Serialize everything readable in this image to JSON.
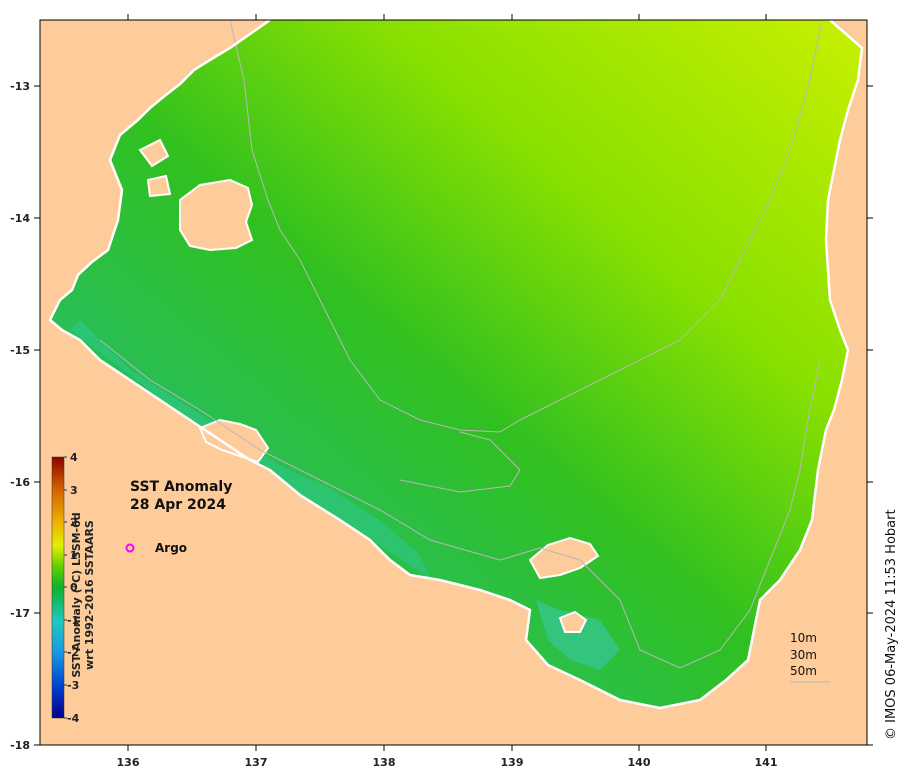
{
  "map": {
    "title": "SST Anomaly",
    "date": "28 Apr 2024",
    "legend_marker_label": "Argo",
    "depth_contours": [
      "10m",
      "30m",
      "50m"
    ],
    "credit": "© IMOS 06-May-2024 11:53 Hobart",
    "lon_ticks": [
      "136",
      "137",
      "138",
      "139",
      "140",
      "141"
    ],
    "lat_ticks": [
      "-13",
      "-14",
      "-15",
      "-16",
      "-17",
      "-18"
    ],
    "colorbar": {
      "title_line1": "SST Anomaly (°C) L3SM-6d",
      "title_line2": "wrt 1992-2016 SSTAARS",
      "ticks": [
        "4",
        "3",
        "2",
        "1",
        "0",
        "-1",
        "-2",
        "-3",
        "-4"
      ],
      "range": [
        -4,
        4
      ]
    },
    "colors": {
      "land": "#fdcc9a",
      "argo_marker": "#ff00ff",
      "anomaly_warm": "#c8f000",
      "anomaly_neutral": "#22c020",
      "anomaly_cool": "#28c6a8"
    }
  }
}
